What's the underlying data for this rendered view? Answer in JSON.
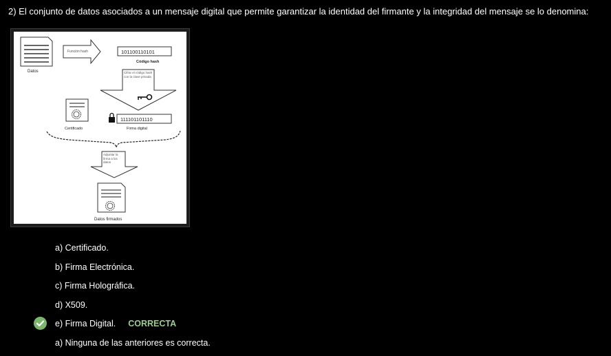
{
  "question": {
    "text": "2) El conjunto de datos asociados a un mensaje digital que permite garantizar la identidad del firmante y la integridad del mensaje se lo denomina:"
  },
  "figure": {
    "hash_function_label": "Función hash",
    "hash_value": "101100110101",
    "hash_code_label": "Código hash",
    "data_label": "Datos",
    "encrypt_step_label": "Cifrar el código hash con la clave privada",
    "signature_value": "111101101110",
    "signature_label": "Firma digital",
    "certificate_label": "Certificado",
    "attach_step_label": "Adjuntar la firma a los datos",
    "signed_data_label": "Datos firmados"
  },
  "answers": [
    {
      "label": "a) Certificado."
    },
    {
      "label": "b) Firma Electrónica."
    },
    {
      "label": "c) Firma Holográfica."
    },
    {
      "label": "d) X509."
    },
    {
      "label": "e) Firma Digital.",
      "tag": "CORRECTA"
    },
    {
      "label": "a) Ninguna de las anteriores es correcta."
    }
  ],
  "colors": {
    "correct": "#79b86b",
    "background": "#000000"
  }
}
